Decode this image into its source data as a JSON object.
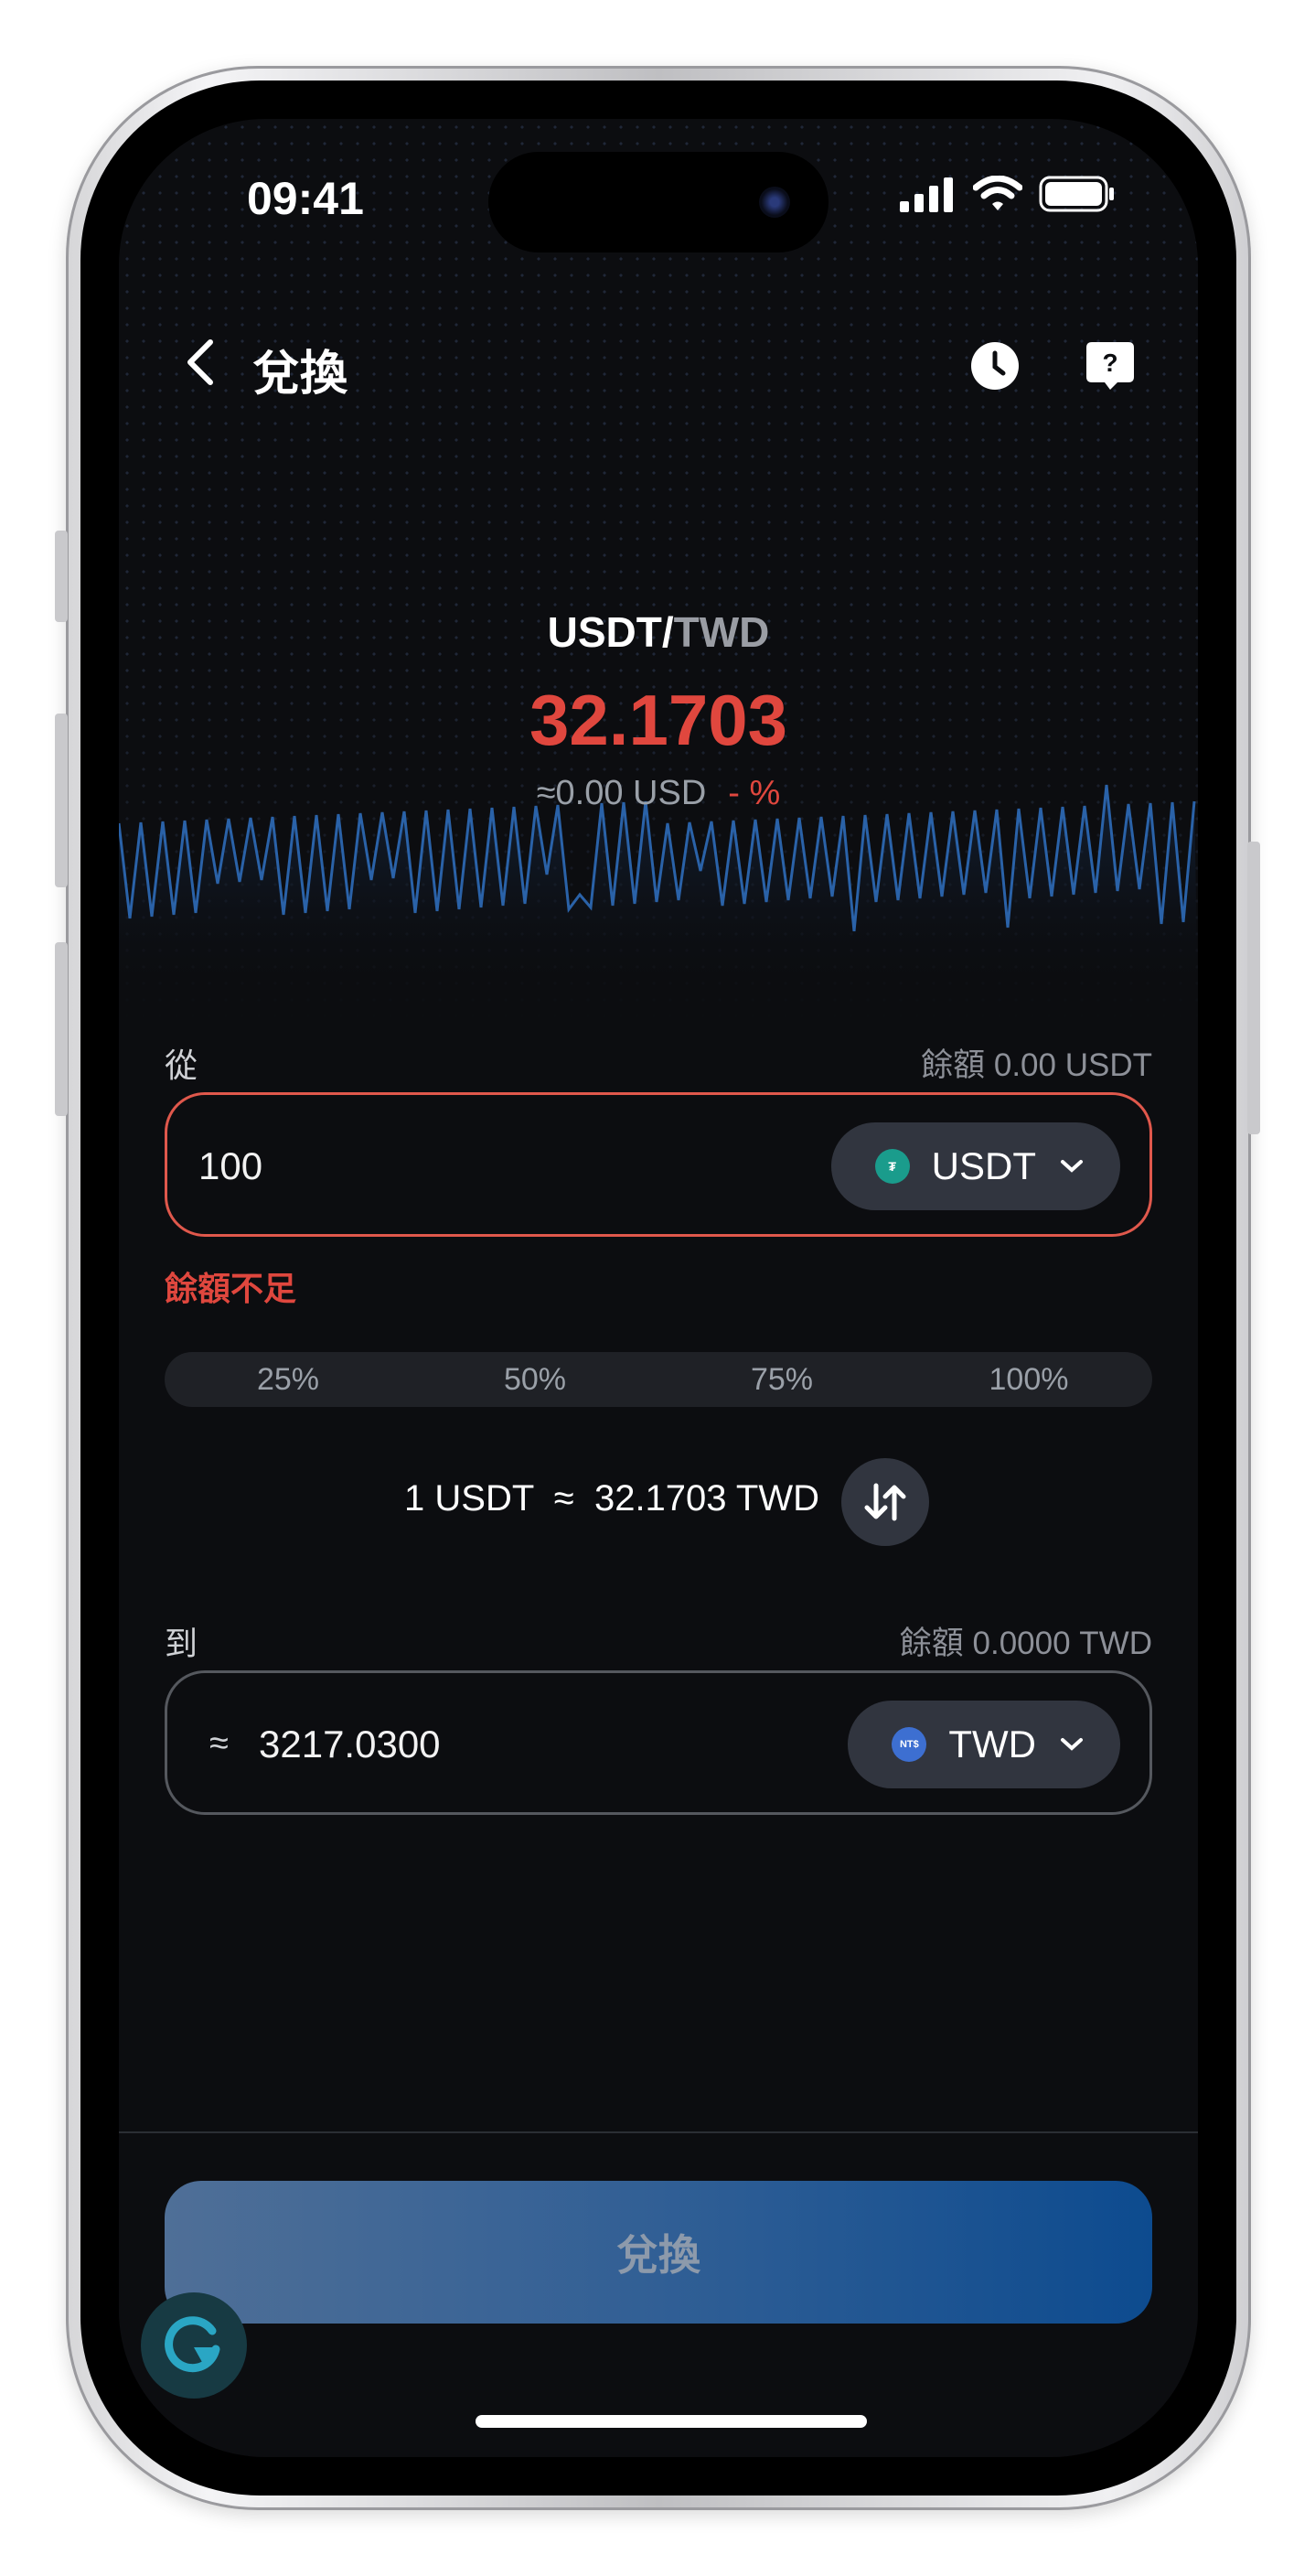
{
  "status_bar": {
    "time": "09:41"
  },
  "header": {
    "title": "兌換",
    "back_icon": "chevron-left-icon",
    "history_icon": "clock-icon",
    "help_icon": "help-bubble-icon"
  },
  "ticker": {
    "base": "USDT",
    "separator": "/",
    "quote": "TWD",
    "rate": "32.1703",
    "usd_value": "≈0.00 USD",
    "change": "- %"
  },
  "from": {
    "label": "從",
    "balance": "餘額 0.00 USDT",
    "amount": "100",
    "token": "USDT",
    "error": "餘額不足"
  },
  "percent_options": [
    "25%",
    "50%",
    "75%",
    "100%"
  ],
  "conversion": {
    "text": "1 USDT  ≈  32.1703 TWD"
  },
  "to": {
    "label": "到",
    "balance": "餘額 0.0000 TWD",
    "approx": "≈",
    "amount": "3217.0300",
    "token": "TWD"
  },
  "submit": {
    "label": "兌換"
  },
  "colors": {
    "accent_red": "#e0473e",
    "background": "#0c0d10",
    "chart_line": "#2a62a8",
    "usdt_icon": "#1a9c8c",
    "twd_icon": "#3d6fd1"
  }
}
